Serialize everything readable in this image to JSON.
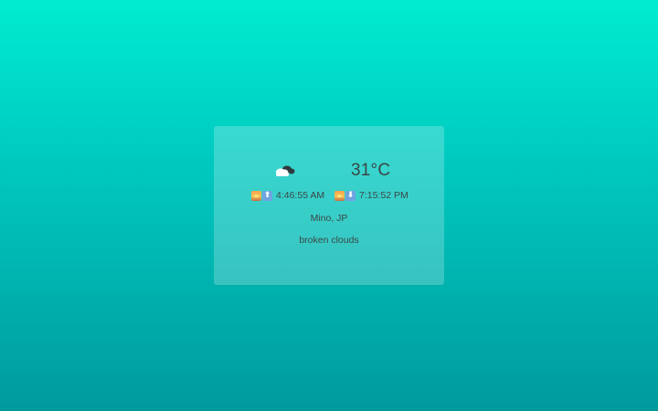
{
  "weather": {
    "condition_icon": "broken-clouds-icon",
    "temperature": "31°C",
    "sunrise": {
      "icons": [
        "sunrise-emoji",
        "up-arrow-emoji"
      ],
      "arrow": "⬆",
      "time": "4:46:55 AM"
    },
    "sunset": {
      "icons": [
        "sunset-emoji",
        "down-arrow-emoji"
      ],
      "arrow": "⬇",
      "time": "7:15:52 PM"
    },
    "location": "Mino, JP",
    "description": "broken clouds"
  },
  "colors": {
    "background_top": "#00ecd0",
    "background_bottom": "#009a9c",
    "text": "#3a4747"
  }
}
